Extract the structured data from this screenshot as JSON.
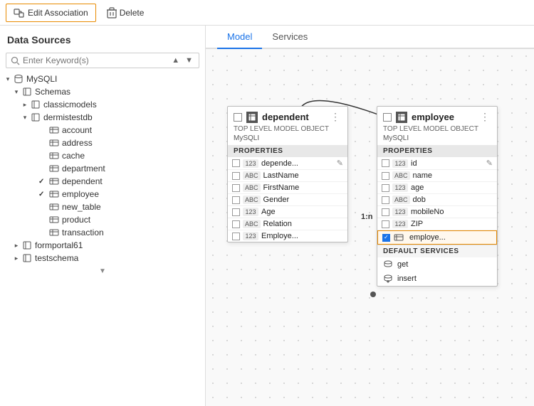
{
  "toolbar": {
    "edit_association_label": "Edit Association",
    "delete_label": "Delete"
  },
  "sidebar": {
    "title": "Data Sources",
    "search_placeholder": "Enter Keyword(s)",
    "tree": [
      {
        "id": "mysql",
        "level": 1,
        "label": "MySQLI",
        "type": "db",
        "state": "open",
        "check": ""
      },
      {
        "id": "schemas",
        "level": 2,
        "label": "Schemas",
        "type": "folder",
        "state": "open",
        "check": ""
      },
      {
        "id": "classicmodels",
        "level": 3,
        "label": "classicmodels",
        "type": "schema",
        "state": "closed",
        "check": ""
      },
      {
        "id": "dermistestdb",
        "level": 3,
        "label": "dermistestdb",
        "type": "schema",
        "state": "open",
        "check": ""
      },
      {
        "id": "account",
        "level": 4,
        "label": "account",
        "type": "table",
        "state": "none",
        "check": ""
      },
      {
        "id": "address",
        "level": 4,
        "label": "address",
        "type": "table",
        "state": "none",
        "check": ""
      },
      {
        "id": "cache",
        "level": 4,
        "label": "cache",
        "type": "table",
        "state": "none",
        "check": ""
      },
      {
        "id": "department",
        "level": 4,
        "label": "department",
        "type": "table",
        "state": "none",
        "check": ""
      },
      {
        "id": "dependent",
        "level": 4,
        "label": "dependent",
        "type": "table",
        "state": "none",
        "check": "✓"
      },
      {
        "id": "employee",
        "level": 4,
        "label": "employee",
        "type": "table",
        "state": "none",
        "check": "✓"
      },
      {
        "id": "new_table",
        "level": 4,
        "label": "new_table",
        "type": "table",
        "state": "none",
        "check": ""
      },
      {
        "id": "product",
        "level": 4,
        "label": "product",
        "type": "table",
        "state": "none",
        "check": ""
      },
      {
        "id": "transaction",
        "level": 4,
        "label": "transaction",
        "type": "table",
        "state": "none",
        "check": ""
      },
      {
        "id": "formportal61",
        "level": 2,
        "label": "formportal61",
        "type": "schema",
        "state": "closed",
        "check": ""
      },
      {
        "id": "testschema",
        "level": 2,
        "label": "testschema",
        "type": "schema",
        "state": "closed",
        "check": ""
      }
    ]
  },
  "tabs": {
    "model_label": "Model",
    "services_label": "Services"
  },
  "dependent_card": {
    "title": "dependent",
    "subtitle": "TOP LEVEL MODEL OBJECT",
    "db": "MySQLI",
    "props_header": "PROPERTIES",
    "properties": [
      {
        "type": "123",
        "name": "depende...",
        "key": true
      },
      {
        "type": "ABC",
        "name": "LastName",
        "key": false
      },
      {
        "type": "ABC",
        "name": "FirstName",
        "key": false
      },
      {
        "type": "ABC",
        "name": "Gender",
        "key": false
      },
      {
        "type": "123",
        "name": "Age",
        "key": false
      },
      {
        "type": "ABC",
        "name": "Relation",
        "key": false
      },
      {
        "type": "123",
        "name": "Employe...",
        "key": false
      }
    ]
  },
  "employee_card": {
    "title": "employee",
    "subtitle": "TOP LEVEL MODEL OBJECT",
    "db": "MySQLI",
    "props_header": "PROPERTIES",
    "properties": [
      {
        "type": "123",
        "name": "id",
        "key": true
      },
      {
        "type": "ABC",
        "name": "name",
        "key": false
      },
      {
        "type": "123",
        "name": "age",
        "key": false
      },
      {
        "type": "ABC",
        "name": "dob",
        "key": false
      },
      {
        "type": "123",
        "name": "mobileNo",
        "key": false
      },
      {
        "type": "123",
        "name": "ZIP",
        "key": false
      },
      {
        "type": "123",
        "name": "employe...",
        "key": false,
        "highlighted": true
      }
    ],
    "default_services_header": "DEFAULT SERVICES",
    "services": [
      {
        "name": "get"
      },
      {
        "name": "insert"
      }
    ]
  },
  "relation": {
    "label": "1:n"
  }
}
